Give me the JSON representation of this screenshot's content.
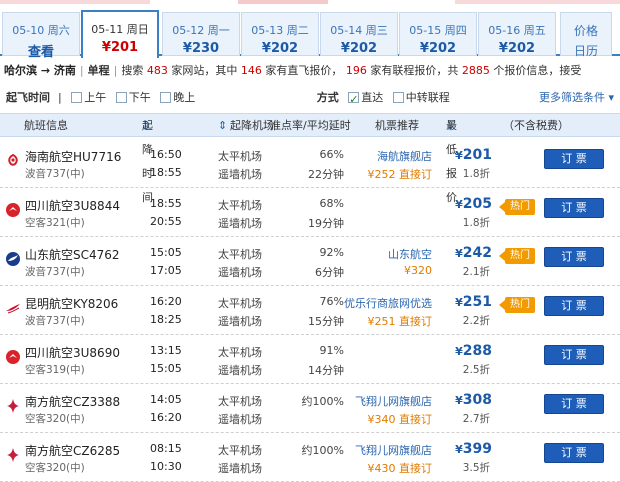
{
  "dates": [
    {
      "date": "05-10 周六",
      "price": "查看"
    },
    {
      "date": "05-11 周日",
      "price": "¥201"
    },
    {
      "date": "05-12 周一",
      "price": "¥230"
    },
    {
      "date": "05-13 周二",
      "price": "¥202"
    },
    {
      "date": "05-14 周三",
      "price": "¥202"
    },
    {
      "date": "05-15 周四",
      "price": "¥202"
    },
    {
      "date": "05-16 周五",
      "price": "¥202"
    }
  ],
  "calendar": {
    "line1": "价格",
    "line2": "日历"
  },
  "search": {
    "route": "哈尔滨 → 济南",
    "sep": "|",
    "trip_type": "单程",
    "t1": "搜索",
    "sites": "483",
    "t2": "家网站，其中",
    "direct": "146",
    "t3": "家有直飞报价，",
    "connect": "196",
    "t4": "家有联程报价，共",
    "quotes": "2885",
    "t5": "个报价信息，接受"
  },
  "filters": {
    "time_label": "起飞时间",
    "morning": "上午",
    "afternoon": "下午",
    "evening": "晚上",
    "mode_label": "方式",
    "direct": "直达",
    "transfer": "中转联程",
    "more": "更多筛选条件"
  },
  "table_header": {
    "flight": "航班信息",
    "time": "起降时间",
    "airport": "起降机场",
    "ontime": "准点率/平均延时",
    "recommend": "机票推荐",
    "price": "最低报价",
    "tax": "（不含税费）"
  },
  "book_label": "订 票",
  "hot_label": "热门",
  "colors": {
    "accent": "#1e5eb8",
    "price": "#1d5aa6",
    "hot": "#f29b00",
    "header_bg": "#e3eefa"
  },
  "flights": [
    {
      "airline": "海南航空HU7716",
      "plane": "波音737(中)",
      "dep": "16:50",
      "arr": "18:55",
      "dep_ap": "太平机场",
      "arr_ap": "遥墙机场",
      "rate": "66%",
      "delay": "22分钟",
      "agent": "海航旗舰店",
      "direct": "¥252 直接订",
      "price": "201",
      "disc": "1.8折",
      "hot": false,
      "logo": "hainan-logo-icon",
      "logo_color": "#d01f2a"
    },
    {
      "airline": "四川航空3U8844",
      "plane": "空客321(中)",
      "dep": "18:55",
      "arr": "20:55",
      "dep_ap": "太平机场",
      "arr_ap": "遥墙机场",
      "rate": "68%",
      "delay": "19分钟",
      "agent": "",
      "direct": "",
      "price": "205",
      "disc": "1.8折",
      "hot": true,
      "logo": "sichuan-logo-icon",
      "logo_color": "#d8232a"
    },
    {
      "airline": "山东航空SC4762",
      "plane": "波音737(中)",
      "dep": "15:05",
      "arr": "17:05",
      "dep_ap": "太平机场",
      "arr_ap": "遥墙机场",
      "rate": "92%",
      "delay": "6分钟",
      "agent": "山东航空",
      "direct": "¥320",
      "price": "242",
      "disc": "2.1折",
      "hot": true,
      "logo": "shandong-logo-icon",
      "logo_color": "#1a3c8c"
    },
    {
      "airline": "昆明航空KY8206",
      "plane": "波音737(中)",
      "dep": "16:20",
      "arr": "18:25",
      "dep_ap": "太平机场",
      "arr_ap": "遥墙机场",
      "rate": "76%",
      "delay": "15分钟",
      "agent": "优乐行商旅网优选",
      "direct": "¥251 直接订",
      "price": "251",
      "disc": "2.2折",
      "hot": true,
      "logo": "kunming-logo-icon",
      "logo_color": "#c8102e"
    },
    {
      "airline": "四川航空3U8690",
      "plane": "空客319(中)",
      "dep": "13:15",
      "arr": "15:05",
      "dep_ap": "太平机场",
      "arr_ap": "遥墙机场",
      "rate": "91%",
      "delay": "14分钟",
      "agent": "",
      "direct": "",
      "price": "288",
      "disc": "2.5折",
      "hot": false,
      "logo": "sichuan-logo-icon",
      "logo_color": "#d8232a"
    },
    {
      "airline": "南方航空CZ3388",
      "plane": "空客320(中)",
      "dep": "14:05",
      "arr": "16:20",
      "dep_ap": "太平机场",
      "arr_ap": "遥墙机场",
      "rate": "约100%",
      "delay": "",
      "agent": "飞翔儿网旗舰店",
      "direct": "¥340 直接订",
      "price": "308",
      "disc": "2.7折",
      "hot": false,
      "logo": "csair-logo-icon",
      "logo_color": "#c41e3a"
    },
    {
      "airline": "南方航空CZ6285",
      "plane": "空客320(中)",
      "dep": "08:15",
      "arr": "10:30",
      "dep_ap": "太平机场",
      "arr_ap": "遥墙机场",
      "rate": "约100%",
      "delay": "",
      "agent": "飞翔儿网旗舰店",
      "direct": "¥430 直接订",
      "price": "399",
      "disc": "3.5折",
      "hot": false,
      "logo": "csair-logo-icon",
      "logo_color": "#c41e3a"
    }
  ]
}
